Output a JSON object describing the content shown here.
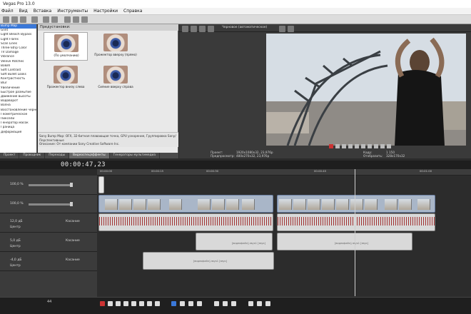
{
  "window": {
    "title": "Vegas Pro 13.0"
  },
  "menu": [
    "Файл",
    "Вид",
    "Вставка",
    "Инструменты",
    "Настройки",
    "Справка"
  ],
  "fx_list": {
    "items": [
      "Bump Map",
      "Glint",
      "Light Bleach Bypass",
      "Light Flares",
      "Scan Lines",
      "Three-Strip Color",
      "TV Damage",
      "Vibrance",
      "Veleve Patches",
      "Bokeh",
      "Soft Contrast",
      "Soft Bullet Looks",
      "Контрастность",
      "Blur",
      "Увеличение",
      "Быстрое размытие",
      "Движение высоты",
      "Водоворот",
      "Волна",
      "Восстановление черного",
      "Геометрическое",
      "Пиксели",
      "Генератор масок",
      "Граница",
      "Деформация"
    ],
    "selected_index": 0
  },
  "presets": {
    "title": "Предустановки:",
    "items": [
      {
        "caption": "(По умолчанию)"
      },
      {
        "caption": "Прожектор вверху (прямо)"
      },
      {
        "caption": "Прожектор внизу слева"
      },
      {
        "caption": "Сияние вверху справа"
      }
    ],
    "description_line1": "Sony Bump Map: OFX, 32-битная плавающая точка, GPU ускорение, Группировка Sony/Перспективные",
    "description_line2": "Описание: От компании Sony Creative Software Inc."
  },
  "tabs": [
    {
      "label": "Проект"
    },
    {
      "label": "Проводник"
    },
    {
      "label": "Переходы"
    },
    {
      "label": "Видеоспецэффекты"
    },
    {
      "label": "Генераторы мультимедиа"
    }
  ],
  "preview": {
    "mode_label": "Черновое (автоматическое)",
    "info_left": [
      "Проект:",
      "Предпросмотр:"
    ],
    "info_left_values": [
      "1920x1080x32, 23,976p",
      "480x270x32, 23,976p"
    ],
    "info_right": [
      "Кадр:",
      "Отобразить:"
    ],
    "info_right_values": [
      "1 150",
      "328x170x32"
    ]
  },
  "timeline": {
    "timecode": "00:00:47,23",
    "ruler_labels": [
      "00:00:00",
      "00:00:15",
      "00:00:30",
      "00:00:45",
      "00:01:00"
    ],
    "tracks": [
      {
        "level": "100,0 %"
      },
      {
        "level": "100,0 %"
      },
      {
        "level": "12,0 дБ",
        "mode": "Касание",
        "pan": "Центр"
      },
      {
        "level": "5,0 дБ",
        "mode": "Касание",
        "pan": "Центр"
      },
      {
        "level": "-4,0 дБ",
        "mode": "Касание",
        "pan": "Центр"
      }
    ],
    "clip_caption": "[видеофайл]-звук1 [звук]",
    "bottom_counter": "44"
  },
  "colors": {
    "selected": "#3a78d8",
    "audio_wave": "#9b2020",
    "video_clip": "#a9b6c8"
  }
}
